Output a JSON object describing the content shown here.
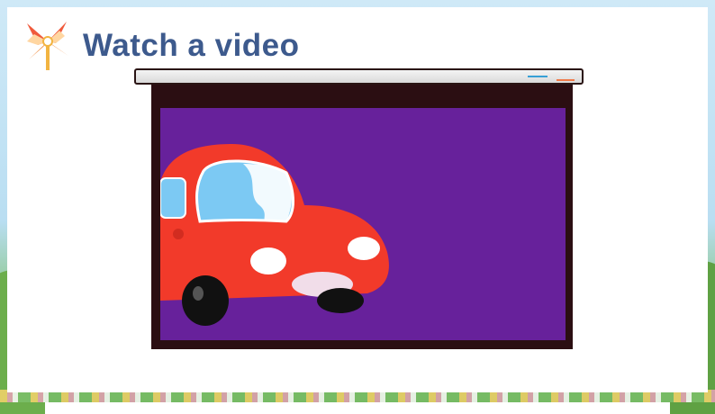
{
  "slide": {
    "title": "Watch a video",
    "accent_color": "#3d5a8d"
  },
  "icons": {
    "title_icon": "pinwheel-icon"
  },
  "video": {
    "screen_color": "#67219b",
    "scene": "red-cartoon-car"
  }
}
